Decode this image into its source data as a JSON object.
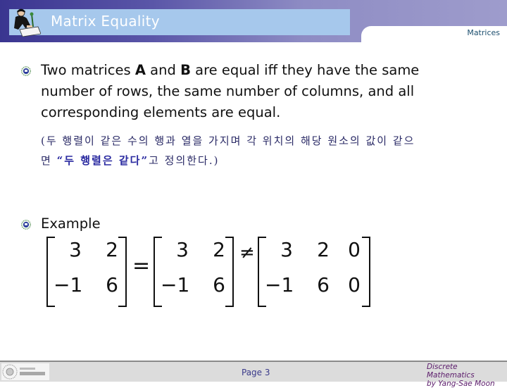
{
  "header": {
    "title": "Matrix Equality",
    "section": "Matrices",
    "logo_icon": "person-writing-icon"
  },
  "bullets": [
    {
      "icon": "emblem-bullet-icon",
      "lines": [
        {
          "parts": [
            {
              "text": "Two matrices ",
              "bold": false
            },
            {
              "text": "A",
              "bold": true
            },
            {
              "text": " and ",
              "bold": false
            },
            {
              "text": "B",
              "bold": true
            },
            {
              "text": " are equal iff they have the same",
              "bold": false
            }
          ]
        },
        {
          "parts": [
            {
              "text": "number of rows, the same number of columns, and all",
              "bold": false
            }
          ]
        },
        {
          "parts": [
            {
              "text": "corresponding elements are equal.",
              "bold": false
            }
          ]
        }
      ]
    },
    {
      "icon": "emblem-bullet-icon",
      "lines": [
        {
          "parts": [
            {
              "text": "Example",
              "bold": false
            }
          ]
        }
      ]
    }
  ],
  "korean_note": {
    "line1": "(두 행렬이 같은 수의 행과 열을 가지며 각 위치의 해당 원소의 값이 같으",
    "line2_prefix": "면 ",
    "line2_bold": "“두 행렬은 같다”",
    "line2_suffix": "고 정의한다.)"
  },
  "example": {
    "matrices": [
      {
        "rows": [
          [
            "3",
            "2"
          ],
          [
            "−1",
            "6"
          ]
        ]
      },
      {
        "rows": [
          [
            "3",
            "2"
          ],
          [
            "−1",
            "6"
          ]
        ]
      },
      {
        "rows": [
          [
            "3",
            "2",
            "0"
          ],
          [
            "−1",
            "6",
            "0"
          ]
        ]
      }
    ],
    "operators": [
      "=",
      "≠"
    ]
  },
  "footer": {
    "page": "Page 3",
    "credit_line1": "Discrete Mathematics",
    "credit_line2": "by Yang-Sae Moon",
    "logo": "university-logo"
  }
}
